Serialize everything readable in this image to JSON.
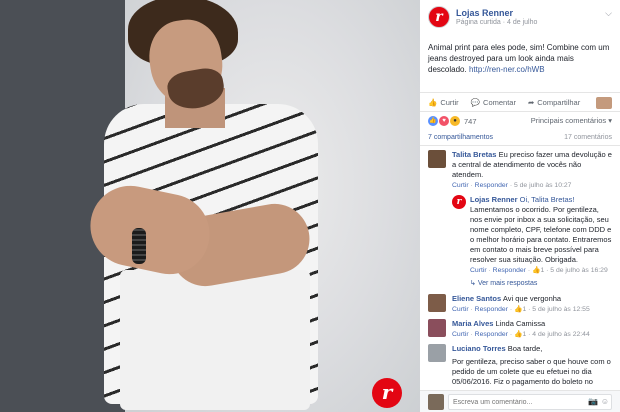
{
  "post": {
    "page_name": "Lojas Renner",
    "page_type": "Página curtida",
    "separator": "·",
    "date": "4 de julho",
    "text": "Animal print para eles pode, sim! Combine com um jeans destroyed para um look ainda mais descolado.",
    "link": "http://ren-ner.co/hWB",
    "brand_letter": "r"
  },
  "actions": {
    "like": "Curtir",
    "comment": "Comentar",
    "share": "Compartilhar"
  },
  "reactions": {
    "count": "747",
    "top_comments": "Principais comentários"
  },
  "counts": {
    "shares": "7 compartilhamentos",
    "comments": "17 comentários"
  },
  "comments": [
    {
      "name": "Talita Bretas",
      "text": "Eu preciso fazer uma devolução e a central de atendimento de vocês não atendem.",
      "like": "Curtir",
      "reply": "Responder",
      "time": "5 de julho às 10:27",
      "avatar_color": "#6b4f3a"
    },
    {
      "name": "Eliene Santos",
      "text": "Avi que vergonha",
      "like": "Curtir",
      "reply": "Responder",
      "time": "5 de julho às 12:55",
      "likes": "1",
      "avatar_color": "#7d5c48"
    },
    {
      "name": "Maria Alves",
      "text": "Linda Camissa",
      "like": "Curtir",
      "reply": "Responder",
      "time": "4 de julho às 22:44",
      "likes": "1",
      "avatar_color": "#8a4e5c"
    },
    {
      "name": "Luciano Torres",
      "text": "Boa tarde,",
      "text2": "Por gentileza, preciso saber o que houve com o pedido de um colete que eu efetuei no dia 05/06/2016. Fiz o pagamento do boleto no mesmo",
      "avatar_color": "#9aa0a6"
    }
  ],
  "reply": {
    "name": "Lojas Renner",
    "mention": "Oi, Talita Bretas!",
    "text": "Lamentamos o ocorrido. Por gentileza, nos envie por inbox a sua solicitação, seu nome completo, CPF, telefone com DDD e o melhor horário para contato. Entraremos em contato o mais breve possível para resolver sua situação. Obrigada.",
    "like": "Curtir",
    "reply": "Responder",
    "likes": "1",
    "time": "5 de julho às 16:29"
  },
  "more_replies": "Ver mais respostas",
  "composer": {
    "placeholder": "Escreva um comentário..."
  }
}
